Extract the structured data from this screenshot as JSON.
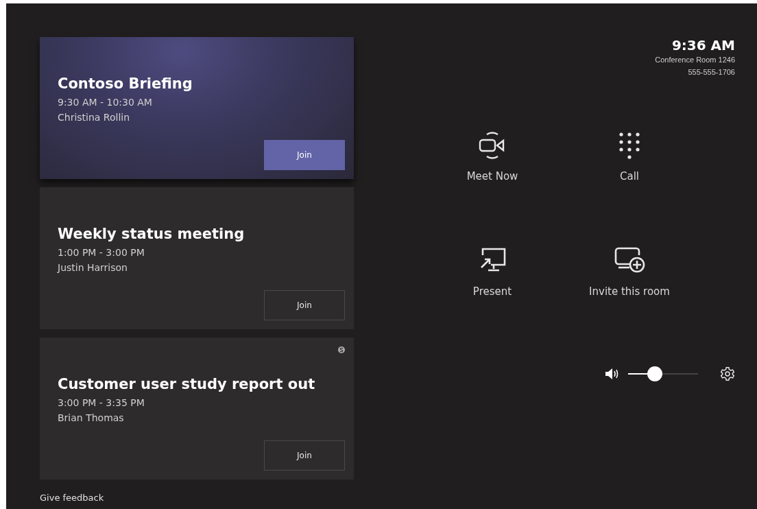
{
  "meetings": [
    {
      "title": "Contoso Briefing",
      "time": "9:30 AM - 10:30 AM",
      "organizer": "Christina Rollin",
      "join": "Join",
      "highlighted": true,
      "badge": false
    },
    {
      "title": "Weekly status meeting",
      "time": "1:00 PM - 3:00 PM",
      "organizer": "Justin Harrison",
      "join": "Join",
      "highlighted": false,
      "badge": false
    },
    {
      "title": "Customer user study report out",
      "time": "3:00 PM - 3:35 PM",
      "organizer": "Brian Thomas",
      "join": "Join",
      "highlighted": false,
      "badge": true
    }
  ],
  "feedback": "Give feedback",
  "clock": {
    "time": "9:36 AM",
    "room": "Conference Room 1246",
    "phone": "555-555-1706"
  },
  "actions": [
    {
      "kind": "meet",
      "label": "Meet Now"
    },
    {
      "kind": "dialpad",
      "label": "Call"
    },
    {
      "kind": "present",
      "label": "Present"
    },
    {
      "kind": "invite",
      "label": "Invite this room"
    }
  ],
  "volume": {
    "level": 0.38
  }
}
